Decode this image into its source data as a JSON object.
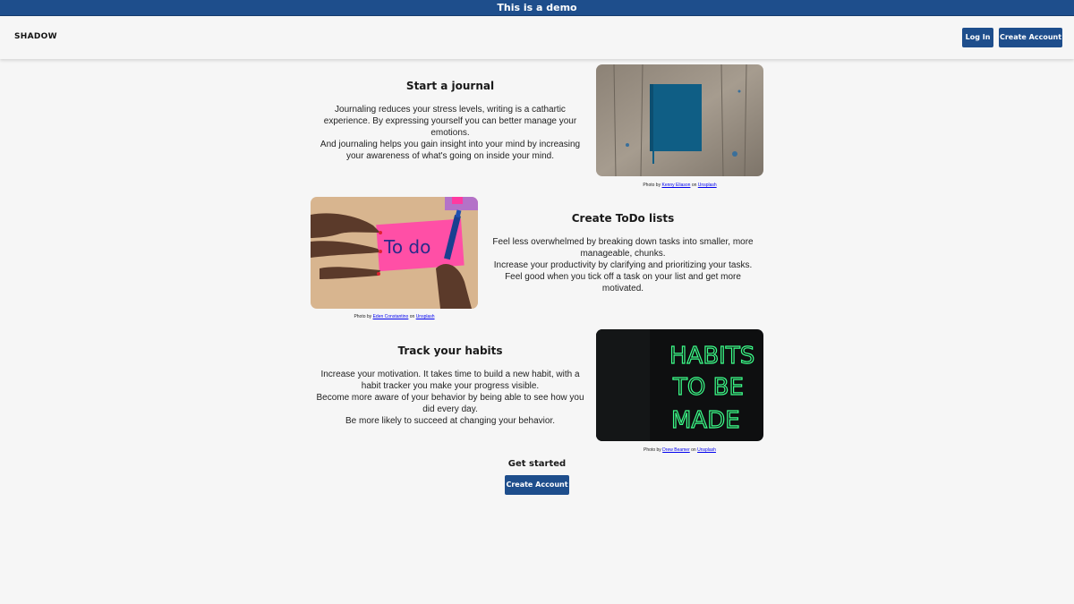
{
  "banner": {
    "text": "This is a demo"
  },
  "navbar": {
    "brand": "SHADOW",
    "login_label": "Log In",
    "create_account_label": "Create Account"
  },
  "sections": [
    {
      "title": "Start a journal",
      "paragraphs": [
        "Journaling reduces your stress levels, writing is a cathartic experience. By expressing yourself you can better manage your emotions.",
        "And journaling helps you gain insight into your mind by increasing your awareness of what's going on inside your mind."
      ],
      "credit": {
        "prefix": "Photo by",
        "author": "Kenny Eliason",
        "on": "on",
        "site": "Unsplash"
      }
    },
    {
      "title": "Create ToDo lists",
      "paragraphs": [
        "Feel less overwhelmed by breaking down tasks into smaller, more manageable, chunks.",
        "Increase your productivity by clarifying and prioritizing your tasks.",
        "Feel good when you tick off a task on your list and get more motivated."
      ],
      "credit": {
        "prefix": "Photo by",
        "author": "Eden Constantino",
        "on": "on",
        "site": "Unsplash"
      },
      "photo_text": "To do"
    },
    {
      "title": "Track your habits",
      "paragraphs": [
        "Increase your motivation. It takes time to build a new habit, with a habit tracker you make your progress visible.",
        "Become more aware of your behavior by being able to see how you did every day.",
        "Be more likely to succeed at changing your behavior."
      ],
      "credit": {
        "prefix": "Photo by",
        "author": "Drew Beamer",
        "on": "on",
        "site": "Unsplash"
      },
      "photo_lines": [
        "HABITS",
        "TO BE",
        "MADE"
      ]
    }
  ],
  "cta": {
    "heading": "Get started",
    "button_label": "Create Account"
  },
  "colors": {
    "primary": "#1e4e8c",
    "background": "#f6f6f6",
    "neon": "#3cff8a"
  }
}
